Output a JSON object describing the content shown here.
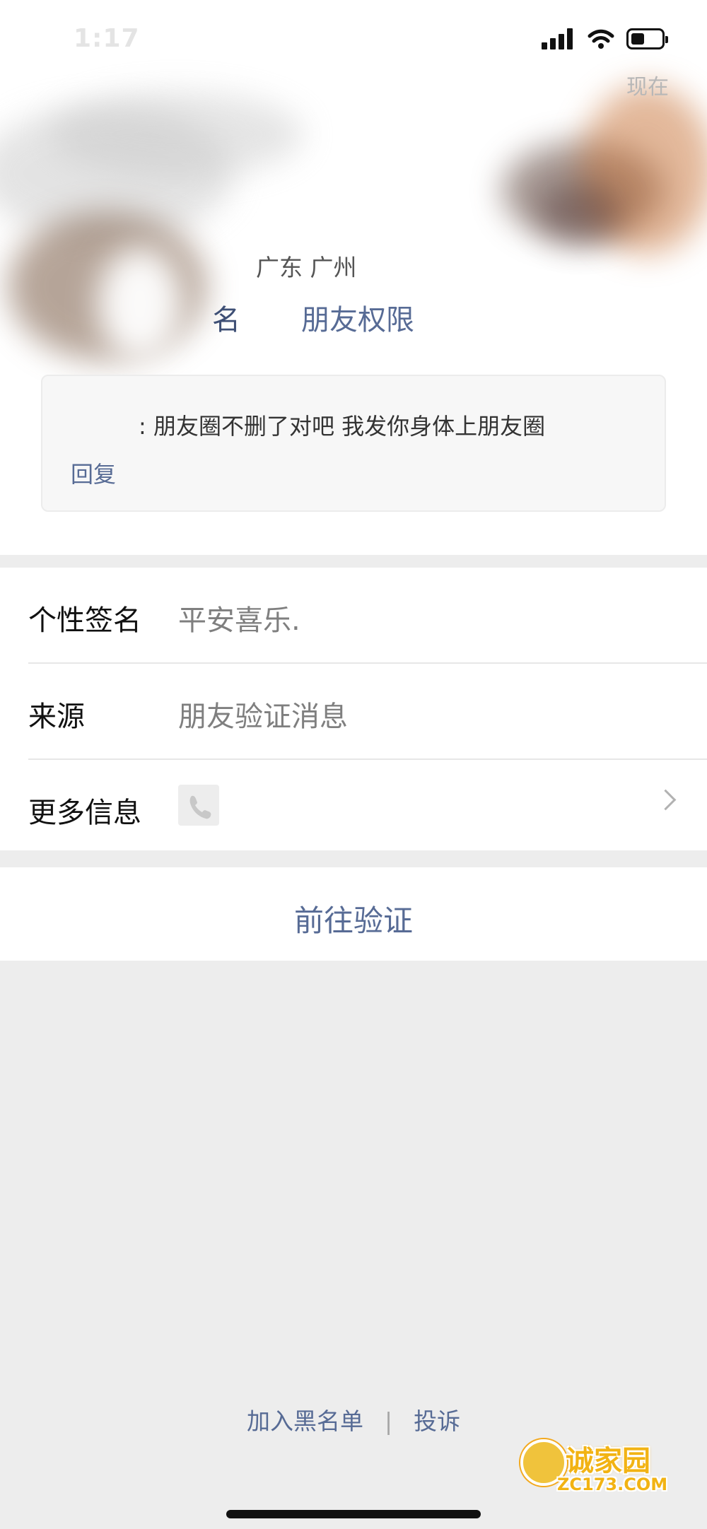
{
  "status_bar": {
    "time": "1:17"
  },
  "profile": {
    "time_tag": "现在",
    "region": "广东 广州",
    "name_partial": "名",
    "friend_permissions": "朋友权限"
  },
  "reply": {
    "prefix": "",
    "message": ": 朋友圈不删了对吧 我发你身体上朋友圈",
    "reply_label": "回复"
  },
  "info": {
    "signature_label": "个性签名",
    "signature_value": "平安喜乐.",
    "source_label": "来源",
    "source_value": "朋友验证消息",
    "more_info_label": "更多信息"
  },
  "actions": {
    "verify_label": "前往验证"
  },
  "footer": {
    "blacklist_label": "加入黑名单",
    "separator": "|",
    "report_label": "投诉"
  },
  "watermark": {
    "text_main": "诚家园",
    "text_sub": "ZC173.COM"
  },
  "colors": {
    "link_blue": "#576b95",
    "background_gray": "#ededed",
    "white": "#ffffff"
  }
}
